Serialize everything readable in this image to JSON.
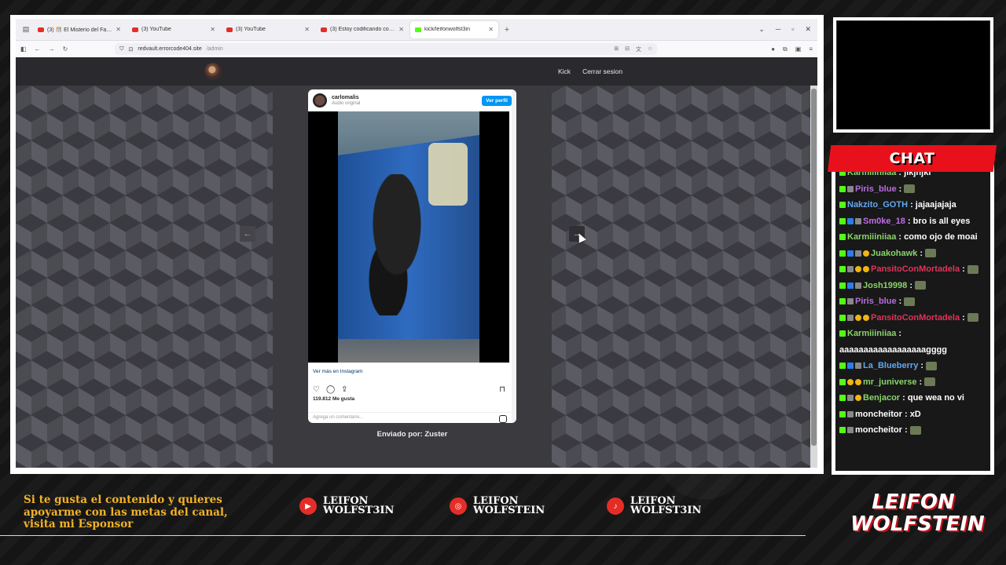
{
  "browser": {
    "tabs": [
      {
        "title": "(3) 🎊 El Misterio del Faro de F",
        "icon": "youtube-icon"
      },
      {
        "title": "(3) YouTube",
        "icon": "youtube-icon"
      },
      {
        "title": "(3) YouTube",
        "icon": "youtube-icon"
      },
      {
        "title": "(3) Estoy codificando con micro",
        "icon": "youtube-icon"
      },
      {
        "title": "kick/leifonwolfst3in",
        "icon": "kick-icon",
        "active": true
      }
    ],
    "url_host": "redvault.errorcode404.site",
    "url_path": "/admin"
  },
  "site": {
    "nav": [
      "Kick",
      "Cerrar sesion"
    ]
  },
  "post": {
    "username": "carlomalis",
    "audio": "Audio original",
    "profile_button": "Ver perfil",
    "view_more": "Ver más en Instagram",
    "likes": "119.812 Me gusta",
    "comment_placeholder": "Agrega un comentario...",
    "sent_by": "Enviado por: Zuster"
  },
  "chat": {
    "title": "CHAT",
    "messages": [
      {
        "user": "Karmiiiniiaa",
        "color": "#8ad36b",
        "text": "jikjhjki",
        "badges": [
          "kick"
        ]
      },
      {
        "user": "Piris_blue",
        "color": "#b86de0",
        "text": "",
        "emote": true,
        "badges": [
          "kick",
          "gray"
        ]
      },
      {
        "user": "Nakzito_GOTH",
        "color": "#62a8f0",
        "text": "jajaajajaja",
        "badges": [
          "kick"
        ]
      },
      {
        "user": "Sm0ke_18",
        "color": "#c06de9",
        "text": "bro is all eyes",
        "badges": [
          "kick",
          "blue",
          "gray"
        ]
      },
      {
        "user": "Karmiiiniiaa",
        "color": "#8ad36b",
        "text": "como ojo de moai",
        "badges": [
          "kick"
        ]
      },
      {
        "user": "Juakohawk",
        "color": "#8ad36b",
        "text": "",
        "emote": true,
        "badges": [
          "kick",
          "blue",
          "gray",
          "gold"
        ]
      },
      {
        "user": "PansitoConMortadela",
        "color": "#e0335a",
        "text": "",
        "emote": true,
        "badges": [
          "kick",
          "gray",
          "gold",
          "gold"
        ]
      },
      {
        "user": "Josh19998",
        "color": "#8ad36b",
        "text": "",
        "emote": true,
        "badges": [
          "kick",
          "blue",
          "gray"
        ]
      },
      {
        "user": "Piris_blue",
        "color": "#b86de0",
        "text": "",
        "emote": true,
        "badges": [
          "kick",
          "gray"
        ]
      },
      {
        "user": "PansitoConMortadela",
        "color": "#e0335a",
        "text": "",
        "emote": true,
        "badges": [
          "kick",
          "gray",
          "gold",
          "gold"
        ]
      },
      {
        "user": "Karmiiiniiaa",
        "color": "#8ad36b",
        "text": "aaaaaaaaaaaaaaaaaagggg",
        "badges": [
          "kick"
        ]
      },
      {
        "user": "La_Blueberry",
        "color": "#62a8f0",
        "text": "",
        "emote": true,
        "badges": [
          "kick",
          "blue",
          "gray"
        ]
      },
      {
        "user": "mr_juniverse",
        "color": "#8ad36b",
        "text": "",
        "emote": true,
        "badges": [
          "kick",
          "gold",
          "gold"
        ]
      },
      {
        "user": "Benjacor",
        "color": "#8ad36b",
        "text": "que wea no vi",
        "badges": [
          "kick",
          "gray",
          "gold"
        ]
      },
      {
        "user": "moncheitor",
        "color": "#ffffff",
        "text": "xD",
        "badges": [
          "kick",
          "gray"
        ]
      },
      {
        "user": "moncheitor",
        "color": "#ffffff",
        "text": "",
        "emote": true,
        "badges": [
          "kick",
          "gray"
        ]
      }
    ]
  },
  "overlay": {
    "sponsor_text": "Si te gusta el contenido y quieres apoyarme con las metas del canal, visita mi Esponsor",
    "socials": [
      {
        "platform": "youtube",
        "icon": "youtube-icon",
        "line1": "LEIFON",
        "line2": "WOLFST3IN"
      },
      {
        "platform": "instagram",
        "icon": "instagram-icon",
        "line1": "LEIFON",
        "line2": "WOLFSTEIN"
      },
      {
        "platform": "tiktok",
        "icon": "tiktok-icon",
        "line1": "LEIFON",
        "line2": "WOLFST3IN"
      }
    ],
    "brand_line1": "LEIFON",
    "brand_line2": "WOLFSTEIN"
  }
}
